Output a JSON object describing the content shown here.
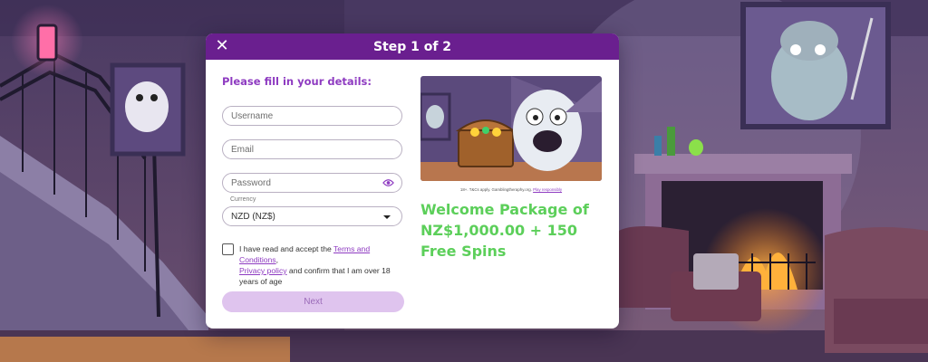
{
  "modal": {
    "title": "Step 1 of 2",
    "close_icon": "close-icon",
    "header_color": "#6a1f8f"
  },
  "form": {
    "heading": "Please fill in your details:",
    "username_placeholder": "Username",
    "email_placeholder": "Email",
    "password_placeholder": "Password",
    "password_toggle_icon": "eye-icon",
    "currency_label": "Currency",
    "currency_value": "NZD (NZ$)",
    "consent_prefix": "I have read and accept the ",
    "terms_link": "Terms and Conditions",
    "consent_comma": ",",
    "privacy_link": "Privacy policy",
    "consent_suffix": " and confirm that I am over 18 years of age",
    "consent_checked": false,
    "next_label": "Next",
    "accent_color": "#8e3bc1"
  },
  "promo": {
    "disclaimer_prefix": "18+. T&Cs apply. Gamblingtheraphy.org. ",
    "disclaimer_link": "Play responsibly",
    "title": "Welcome Package of NZ$1,000.00 + 150 Free Spins",
    "title_color": "#5ccf5a"
  }
}
